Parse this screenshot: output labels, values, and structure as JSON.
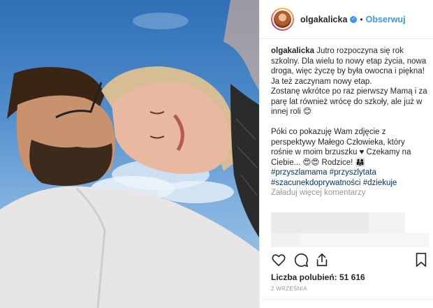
{
  "header": {
    "username": "olgakalicka",
    "verified_icon": "✓",
    "separator": "•",
    "follow_label": "Obserwuj"
  },
  "caption": {
    "owner": "olgakalicka",
    "line1": "Jutro rozpoczyna się rok szkolny. Dla wielu to nowy etap życia, nowa droga, więc życzę by była owocna i piękna!",
    "line2": "Ja też zaczynam nowy etap.",
    "line3": "Zostanę wkrótce po raz pierwszy Mamą i za parę lat również wrócę do szkoły, ale już w innej roli 😊",
    "line4": "Póki co pokazuję Wam zdjęcie z perspektywy Małego Człowieka, który rośnie w moim brzuszku ♥ Czekamy na Ciebie... 😍😍 Rodzice! 👨‍👩‍👧",
    "hashtags": [
      "#przyszlamama",
      "#przyszlytata",
      "#szacunekdoprywatności",
      "#dziekuje"
    ]
  },
  "load_more_label": "Załaduj więcej komentarzy",
  "icons": {
    "like": "heart-icon",
    "comment": "comment-icon",
    "share": "share-icon",
    "save": "bookmark-icon"
  },
  "likes_label": "Liczba polubień: 51 616",
  "date_label": "2 WRZEŚNIA",
  "colors": {
    "link": "#3897f0",
    "hashtag": "#003569",
    "muted": "#999999"
  }
}
